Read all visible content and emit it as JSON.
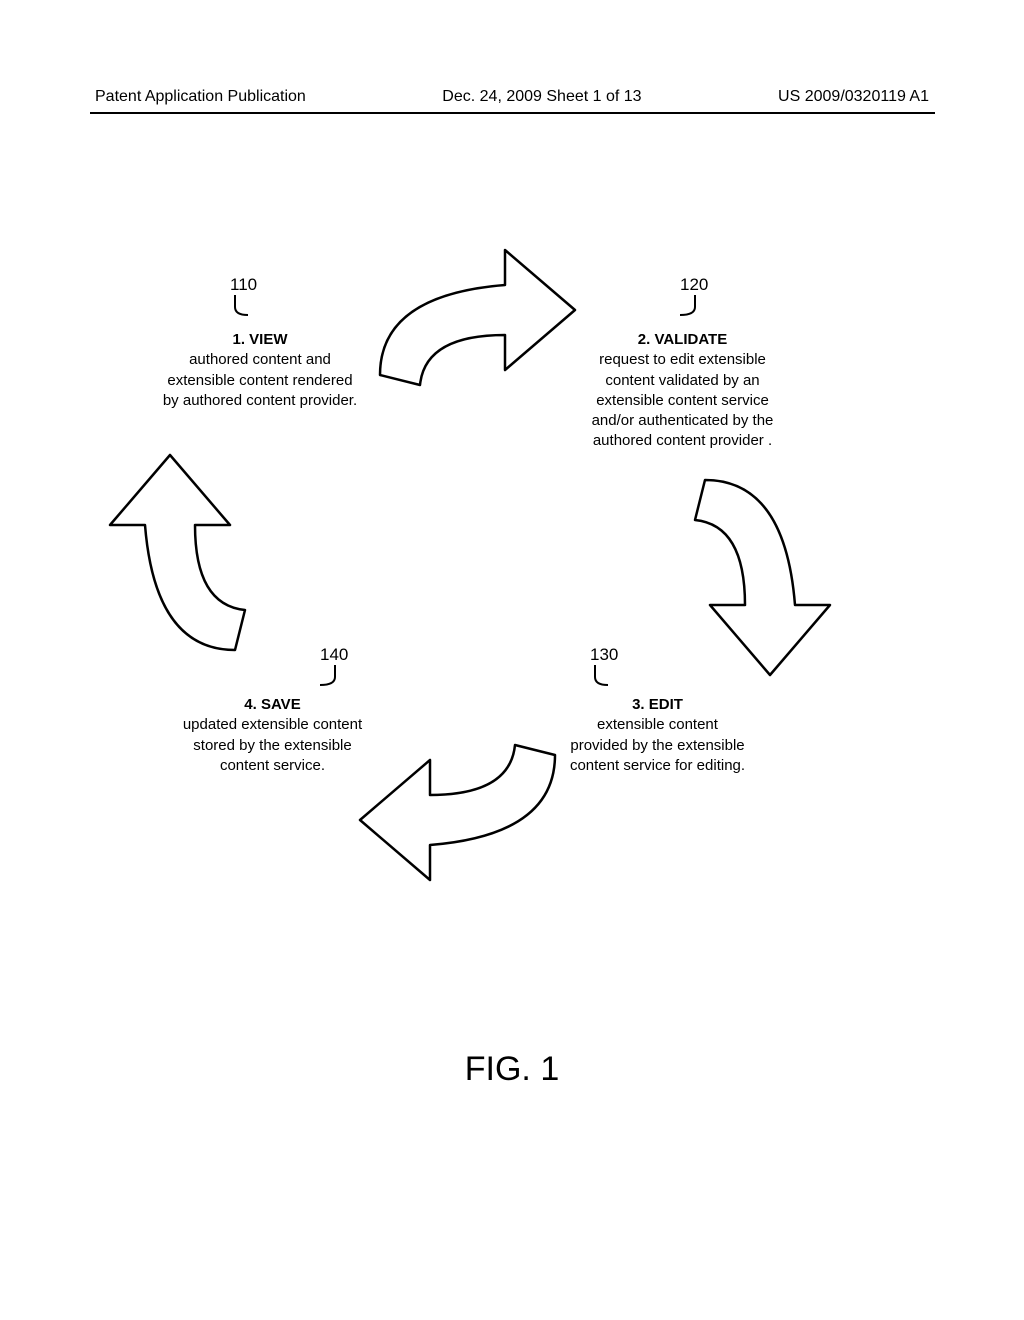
{
  "header": {
    "left": "Patent Application Publication",
    "center": "Dec. 24, 2009  Sheet 1 of 13",
    "right": "US 2009/0320119 A1"
  },
  "refs": {
    "r110": "110",
    "r120": "120",
    "r130": "130",
    "r140": "140"
  },
  "steps": {
    "s1": {
      "title": "1.  VIEW",
      "body": "authored content and\nextensible content rendered\nby authored content provider."
    },
    "s2": {
      "title": "2.  VALIDATE",
      "body": "request to edit extensible\ncontent validated by an\nextensible content service\nand/or authenticated by the\nauthored content provider ."
    },
    "s3": {
      "title": "3.  EDIT",
      "body": "extensible content\nprovided by the extensible\ncontent service for editing."
    },
    "s4": {
      "title": "4.  SAVE",
      "body": "updated extensible content\nstored by the extensible\ncontent service."
    }
  },
  "figure": "FIG. 1"
}
